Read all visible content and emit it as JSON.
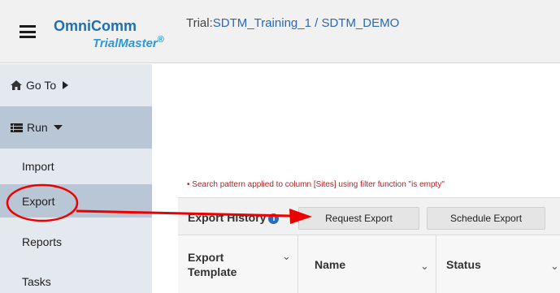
{
  "header": {
    "brand": "OmniComm",
    "product": "TrialMaster",
    "product_mark": "®",
    "trial_prefix": "Trial:",
    "trial_path": "SDTM_Training_1 / SDTM_DEMO"
  },
  "sidebar": {
    "goto_label": "Go To",
    "run_label": "Run",
    "items": [
      {
        "label": "Import"
      },
      {
        "label": "Export"
      },
      {
        "label": "Reports"
      },
      {
        "label": "Tasks"
      }
    ]
  },
  "filter_note": "• Search pattern applied to column [Sites] using filter function \"is empty\"",
  "export_history": {
    "title": "Export History",
    "request_button": "Request Export",
    "schedule_button": "Schedule Export",
    "columns": [
      {
        "label": "Export Template"
      },
      {
        "label": "Name"
      },
      {
        "label": "Status"
      }
    ]
  },
  "colors": {
    "brand_blue": "#1f6fb3",
    "product_blue": "#2c9ad6",
    "sidebar_bg": "#e4e9ef",
    "sidebar_active": "#b9c6d5",
    "annotation_red": "#ee0000",
    "filter_note_red": "#b22424"
  },
  "icons": [
    "hamburger-menu-icon",
    "home-icon",
    "caret-right-icon",
    "run-list-icon",
    "caret-down-icon",
    "info-icon",
    "chevron-down-icon"
  ]
}
